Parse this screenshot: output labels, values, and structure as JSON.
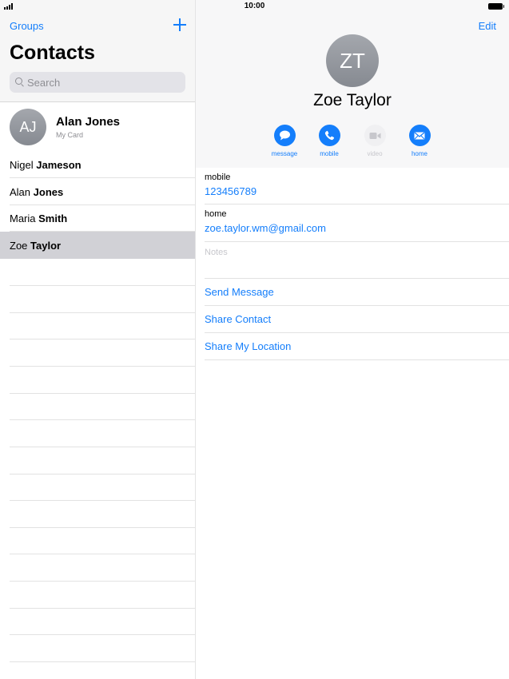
{
  "status_bar": {
    "time": "10:00"
  },
  "sidebar": {
    "groups_label": "Groups",
    "title": "Contacts",
    "search": {
      "placeholder": "Search",
      "value": ""
    },
    "my_card": {
      "initials": "AJ",
      "name": "Alan Jones",
      "subtitle": "My Card"
    },
    "contacts": [
      {
        "first": "Nigel",
        "last": "Jameson",
        "selected": false
      },
      {
        "first": "Alan",
        "last": "Jones",
        "selected": false
      },
      {
        "first": "Maria",
        "last": "Smith",
        "selected": false
      },
      {
        "first": "Zoe",
        "last": "Taylor",
        "selected": true
      }
    ]
  },
  "detail": {
    "edit_label": "Edit",
    "initials": "ZT",
    "name": "Zoe Taylor",
    "actions": [
      {
        "label": "message",
        "icon": "message-icon",
        "enabled": true
      },
      {
        "label": "mobile",
        "icon": "phone-icon",
        "enabled": true
      },
      {
        "label": "video",
        "icon": "video-icon",
        "enabled": false
      },
      {
        "label": "home",
        "icon": "mail-icon",
        "enabled": true
      }
    ],
    "fields": [
      {
        "label": "mobile",
        "value": "123456789"
      },
      {
        "label": "home",
        "value": "zoe.taylor.wm@gmail.com"
      }
    ],
    "notes_placeholder": "Notes",
    "links": [
      "Send Message",
      "Share Contact",
      "Share My Location"
    ]
  },
  "colors": {
    "accent": "#147efb",
    "selected_row": "#d1d1d6"
  }
}
